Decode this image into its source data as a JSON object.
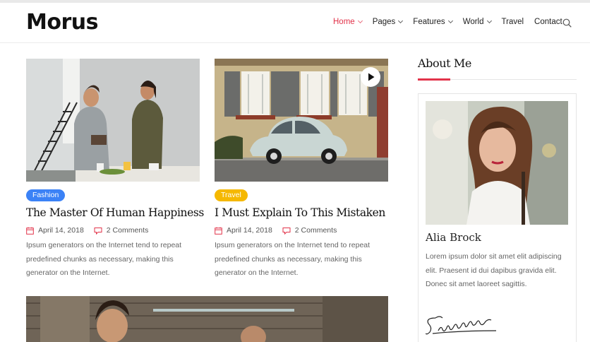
{
  "site": {
    "logo": "Morus"
  },
  "nav": {
    "items": [
      {
        "label": "Home",
        "active": true,
        "dropdown": true
      },
      {
        "label": "Pages",
        "active": false,
        "dropdown": true
      },
      {
        "label": "Features",
        "active": false,
        "dropdown": true
      },
      {
        "label": "World",
        "active": false,
        "dropdown": true
      },
      {
        "label": "Travel",
        "active": false,
        "dropdown": false
      },
      {
        "label": "Contact",
        "active": false,
        "dropdown": false
      }
    ],
    "search_icon": "search-icon",
    "active_color": "#e2334a"
  },
  "posts": [
    {
      "category": "Fashion",
      "category_color": "#3b82f6",
      "title": "The Master Of Human Happiness",
      "date": "April 14, 2018",
      "comments": "2 Comments",
      "excerpt": "Ipsum generators on the Internet tend to repeat predefined chunks as necessary, making this generator on the Internet.",
      "image": "couple-in-kitchen-photo"
    },
    {
      "category": "Travel",
      "category_color": "#f5b800",
      "title": "I Must Explain To This Mistaken",
      "date": "April 14, 2018",
      "comments": "2 Comments",
      "excerpt": "Ipsum generators on the Internet tend to repeat predefined chunks as necessary, making this generator on the Internet.",
      "image": "vintage-car-street-photo",
      "has_video": true
    },
    {
      "image": "friends-wooden-wall-photo"
    }
  ],
  "sidebar": {
    "about": {
      "title": "About Me",
      "name": "Alia Brock",
      "bio": "Lorem ipsum dolor sit amet elit adipiscing elit. Praesent id dui dapibus gravida elit. Donec sit amet laoreet sagittis.",
      "signature": "Signature",
      "photo": "author-portrait-photo",
      "accent_color": "#e2334a"
    }
  },
  "icons": {
    "date": "calendar-icon",
    "comments": "comment-icon",
    "play": "play-icon"
  }
}
